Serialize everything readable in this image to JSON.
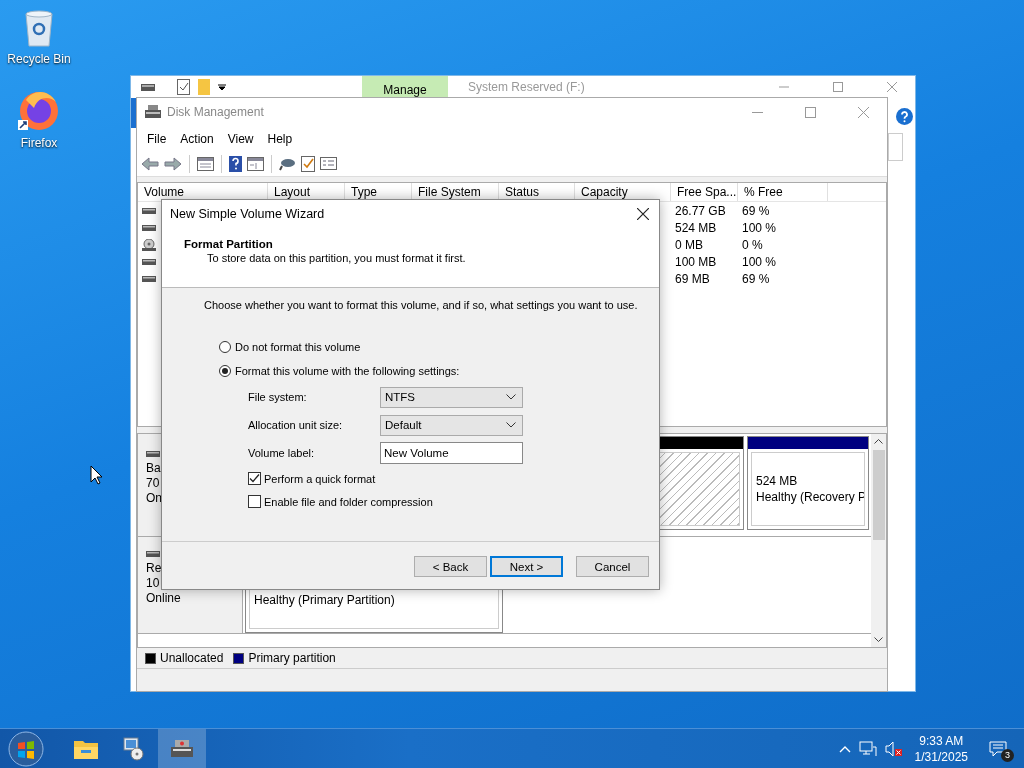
{
  "desktop_icons": [
    {
      "label": "Recycle Bin",
      "kind": "recycle"
    },
    {
      "label": "Firefox",
      "kind": "firefox"
    }
  ],
  "explorer_window": {
    "ribbon_tab": "Manage",
    "title": "System Reserved (F:)"
  },
  "disk_management": {
    "title": "Disk Management",
    "menu": [
      "File",
      "Action",
      "View",
      "Help"
    ],
    "columns": [
      "Volume",
      "Layout",
      "Type",
      "File System",
      "Status",
      "Capacity",
      "Free Spa...",
      "% Free"
    ],
    "rows": [
      {
        "kind": "disk",
        "free_space": "26.77 GB",
        "percent_free": "69 %"
      },
      {
        "kind": "disk",
        "free_space": "524 MB",
        "percent_free": "100 %"
      },
      {
        "kind": "cd",
        "free_space": "0 MB",
        "percent_free": "0 %"
      },
      {
        "kind": "disk",
        "free_space": "100 MB",
        "percent_free": "100 %"
      },
      {
        "kind": "disk",
        "free_space": "69 MB",
        "percent_free": "69 %"
      }
    ],
    "disks": [
      {
        "label_lines": [
          "Ba",
          "70",
          "On"
        ],
        "partitions": [
          {
            "kind": "unallocated"
          },
          {
            "kind": "primary",
            "lines": [
              "524 MB",
              "Healthy (Recovery P"
            ]
          }
        ]
      },
      {
        "label_lines": [
          "Re",
          "10",
          "Online"
        ],
        "partitions": [
          {
            "kind": "primary",
            "lines": [
              "Healthy (Primary Partition)"
            ]
          }
        ]
      }
    ],
    "legend": [
      {
        "label": "Unallocated",
        "color": "#000000"
      },
      {
        "label": "Primary partition",
        "color": "#000080"
      }
    ]
  },
  "dialog": {
    "title": "New Simple Volume Wizard",
    "heading": "Format Partition",
    "subheading": "To store data on this partition, you must format it first.",
    "instruction": "Choose whether you want to format this volume, and if so, what settings you want to use.",
    "options": [
      {
        "label": "Do not format this volume",
        "selected": false
      },
      {
        "label": "Format this volume with the following settings:",
        "selected": true
      }
    ],
    "fields": [
      {
        "kind": "dropdown",
        "label": "File system:",
        "value": "NTFS"
      },
      {
        "kind": "dropdown",
        "label": "Allocation unit size:",
        "value": "Default"
      },
      {
        "kind": "text",
        "label": "Volume label:",
        "value": "New Volume"
      }
    ],
    "checkboxes": [
      {
        "label": "Perform a quick format",
        "checked": true
      },
      {
        "label": "Enable file and folder compression",
        "checked": false
      }
    ],
    "buttons": [
      {
        "label": "< Back",
        "default": false
      },
      {
        "label": "Next >",
        "default": true
      },
      {
        "label": "Cancel",
        "default": false
      }
    ]
  },
  "taskbar": {
    "apps": [
      {
        "kind": "folder",
        "active": false
      },
      {
        "kind": "computer",
        "active": false
      },
      {
        "kind": "disk",
        "active": true
      }
    ],
    "time": "9:33 AM",
    "date": "1/31/2025",
    "notifications": "3"
  }
}
